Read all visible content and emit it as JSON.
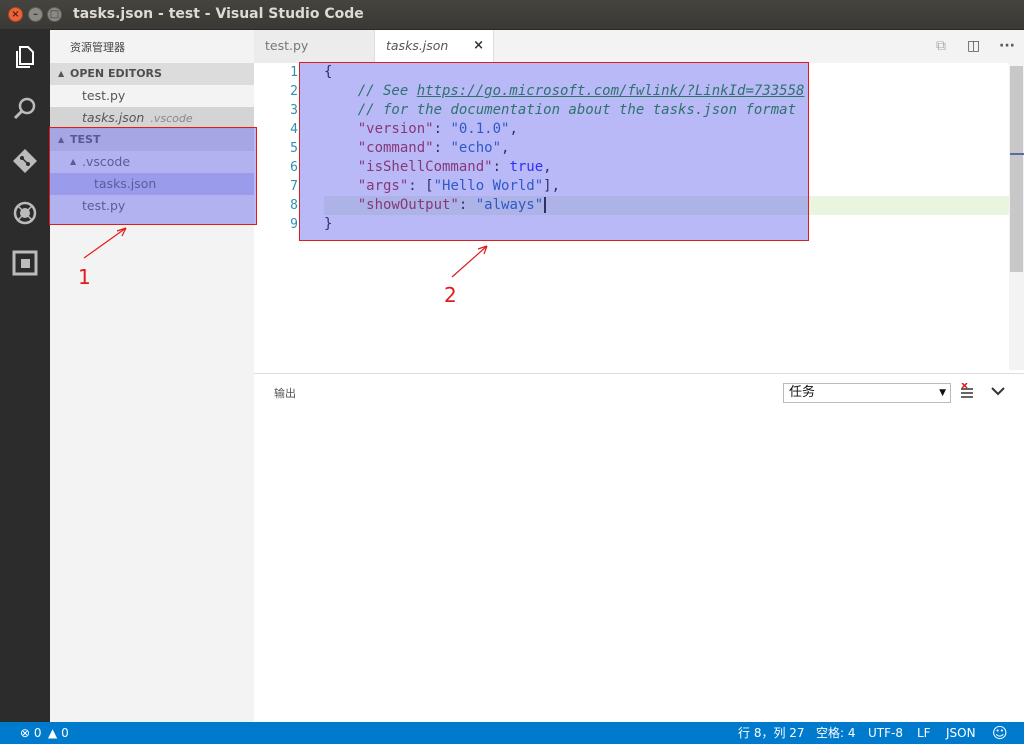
{
  "window": {
    "title": "tasks.json - test - Visual Studio Code"
  },
  "activity_bar": {
    "icons": [
      "files-icon",
      "search-icon",
      "git-icon",
      "debug-icon",
      "extensions-icon"
    ]
  },
  "sidebar": {
    "title": "资源管理器",
    "open_editors": {
      "label": "OPEN EDITORS",
      "items": [
        {
          "name": "test.py",
          "hint": ""
        },
        {
          "name": "tasks.json",
          "hint": ".vscode"
        }
      ]
    },
    "project": {
      "label": "TEST",
      "folder": ".vscode",
      "folder_child": "tasks.json",
      "file": "test.py"
    }
  },
  "tabs": [
    {
      "label": "test.py",
      "active": false
    },
    {
      "label": "tasks.json",
      "active": true,
      "close": "×"
    }
  ],
  "editor": {
    "lines": [
      {
        "n": "1",
        "parts": [
          [
            "punc",
            "{"
          ]
        ]
      },
      {
        "n": "2",
        "parts": [
          [
            "cmt",
            "    // See "
          ],
          [
            "lnk",
            "https://go.microsoft.com/fwlink/?LinkId=733558"
          ]
        ]
      },
      {
        "n": "3",
        "parts": [
          [
            "cmt",
            "    // for the documentation about the tasks.json format"
          ]
        ]
      },
      {
        "n": "4",
        "parts": [
          [
            "punc",
            "    "
          ],
          [
            "key",
            "\"version\""
          ],
          [
            "punc",
            ": "
          ],
          [
            "str",
            "\"0.1.0\""
          ],
          [
            "punc",
            ","
          ]
        ]
      },
      {
        "n": "5",
        "parts": [
          [
            "punc",
            "    "
          ],
          [
            "key",
            "\"command\""
          ],
          [
            "punc",
            ": "
          ],
          [
            "str",
            "\"echo\""
          ],
          [
            "punc",
            ","
          ]
        ]
      },
      {
        "n": "6",
        "parts": [
          [
            "punc",
            "    "
          ],
          [
            "key",
            "\"isShellCommand\""
          ],
          [
            "punc",
            ": "
          ],
          [
            "kw",
            "true"
          ],
          [
            "punc",
            ","
          ]
        ]
      },
      {
        "n": "7",
        "parts": [
          [
            "punc",
            "    "
          ],
          [
            "key",
            "\"args\""
          ],
          [
            "punc",
            ": ["
          ],
          [
            "str",
            "\"Hello World\""
          ],
          [
            "punc",
            "],"
          ]
        ]
      },
      {
        "n": "8",
        "parts": [
          [
            "punc",
            "    "
          ],
          [
            "key",
            "\"showOutput\""
          ],
          [
            "punc",
            ": "
          ],
          [
            "str",
            "\"always\""
          ]
        ]
      },
      {
        "n": "9",
        "parts": [
          [
            "punc",
            "}"
          ]
        ]
      }
    ]
  },
  "panel": {
    "title": "输出",
    "select_value": "任务"
  },
  "statusbar": {
    "errors": "0",
    "warnings": "0",
    "position": "行 8，列 27",
    "spaces": "空格: 4",
    "encoding": "UTF-8",
    "eol": "LF",
    "language": "JSON"
  },
  "annotations": {
    "label1": "1",
    "label2": "2",
    "color": "#e01b1b"
  }
}
